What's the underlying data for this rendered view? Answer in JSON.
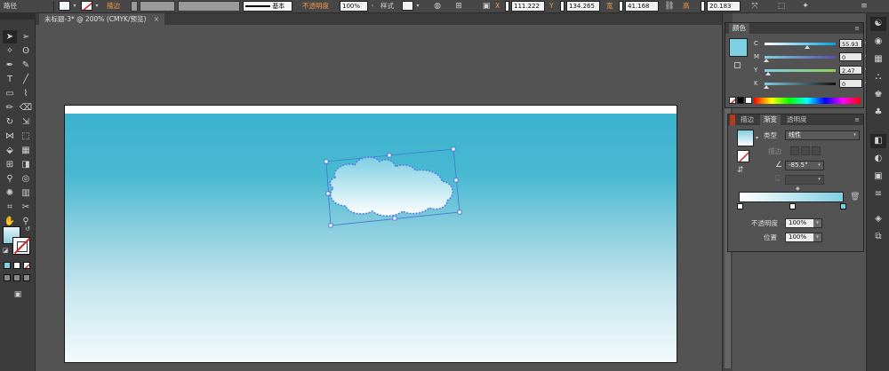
{
  "control_bar": {
    "object_type": "路径",
    "stroke_label": "描边",
    "stroke_style": "基本",
    "opacity_label": "不透明度",
    "opacity_value": "100%",
    "style_label": "样式",
    "x_label": "X",
    "x_value": "111.222",
    "y_label": "Y",
    "y_value": "134.265",
    "w_label": "宽",
    "w_value": "41.168",
    "h_label": "高",
    "h_value": "20.183"
  },
  "document": {
    "tab_title": "未标题-3* @ 200% (CMYK/预览)",
    "close_glyph": "×"
  },
  "color_panel": {
    "tab_label": "颜色",
    "accent": "#7fcfe3",
    "channels": [
      {
        "name": "C",
        "value": "55.93",
        "unit": "%"
      },
      {
        "name": "M",
        "value": "0",
        "unit": "%"
      },
      {
        "name": "Y",
        "value": "2.47",
        "unit": "%"
      },
      {
        "name": "K",
        "value": "0",
        "unit": "%"
      }
    ]
  },
  "gradient_panel": {
    "tabs": [
      "描边",
      "渐变",
      "透明度"
    ],
    "active_tab": "渐变",
    "type_label": "类型",
    "type_value": "线性",
    "stroke_label": "描边",
    "angle_value": "-85.5°",
    "ramp_start": "#ffffff",
    "ramp_end": "#7fcfe3",
    "opacity_label": "不透明度",
    "opacity_value": "100%",
    "location_label": "位置",
    "location_value": "100%"
  }
}
